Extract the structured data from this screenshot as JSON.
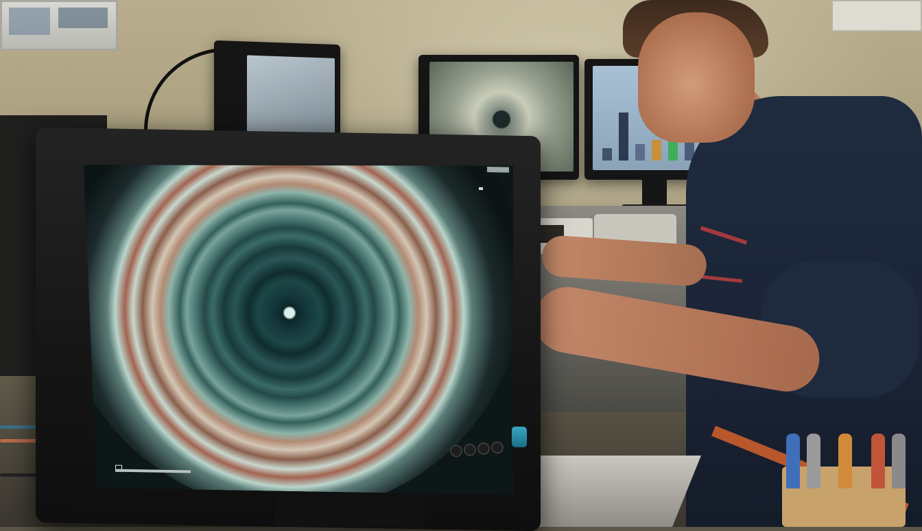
{
  "scene": {
    "description_free": true,
    "screen_osd": {
      "top_left_label": "",
      "top_right_label": "",
      "bottom_right_label": ""
    },
    "colors": {
      "monitor_power_button": "#2a93b2",
      "shirt": "#1f2b3f",
      "shirt_stripe": "#a33a3d"
    },
    "icons": {
      "main_monitor_buttons": [
        "menu-button-icon",
        "down-button-icon",
        "up-button-icon",
        "select-button-icon"
      ],
      "power": "power-button-icon"
    }
  }
}
